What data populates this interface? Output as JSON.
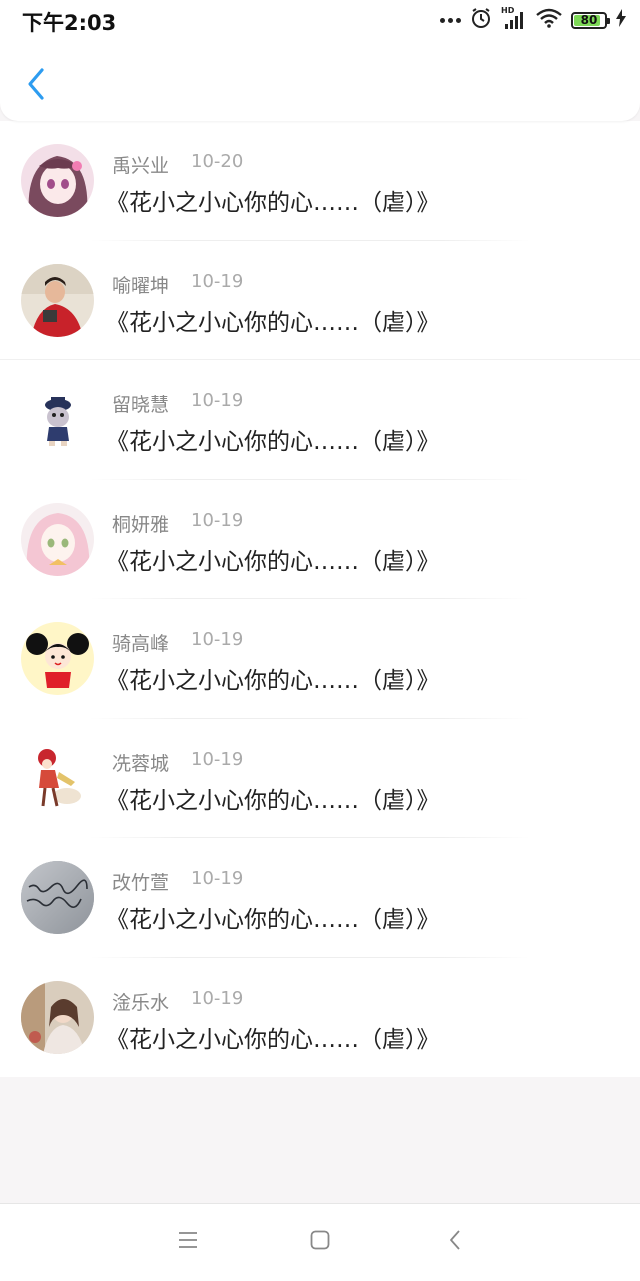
{
  "status_bar": {
    "time": "下午2:03",
    "network_label": "HD",
    "battery_level": "80",
    "icons": [
      "more-dots-icon",
      "alarm-icon",
      "signal-icon",
      "wifi-icon",
      "battery-icon",
      "charging-icon"
    ]
  },
  "header": {
    "back_icon": "chevron-left-icon"
  },
  "title_text": "《花小之小心你的心……（虐）》",
  "rows": [
    {
      "name": "禹兴业",
      "date": "10-20",
      "title": "《花小之小心你的心……（虐）》"
    },
    {
      "name": "喻曜坤",
      "date": "10-19",
      "title": "《花小之小心你的心……（虐）》"
    },
    {
      "name": "留晓慧",
      "date": "10-19",
      "title": "《花小之小心你的心……（虐）》"
    },
    {
      "name": "桐妍雅",
      "date": "10-19",
      "title": "《花小之小心你的心……（虐）》"
    },
    {
      "name": "骑高峰",
      "date": "10-19",
      "title": "《花小之小心你的心……（虐）》"
    },
    {
      "name": "冼蓉城",
      "date": "10-19",
      "title": "《花小之小心你的心……（虐）》"
    },
    {
      "name": "改竹萱",
      "date": "10-19",
      "title": "《花小之小心你的心……（虐）》"
    },
    {
      "name": "淦乐水",
      "date": "10-19",
      "title": "《花小之小心你的心……（虐）》"
    }
  ],
  "nav_bar": {
    "icons": [
      "menu-icon",
      "home-square-icon",
      "back-triangle-icon"
    ]
  },
  "colors": {
    "accent": "#2d9cf0",
    "name_text": "#888888",
    "date_text": "#aaaaaa",
    "title_text": "#222222",
    "battery": "#7ed957"
  }
}
